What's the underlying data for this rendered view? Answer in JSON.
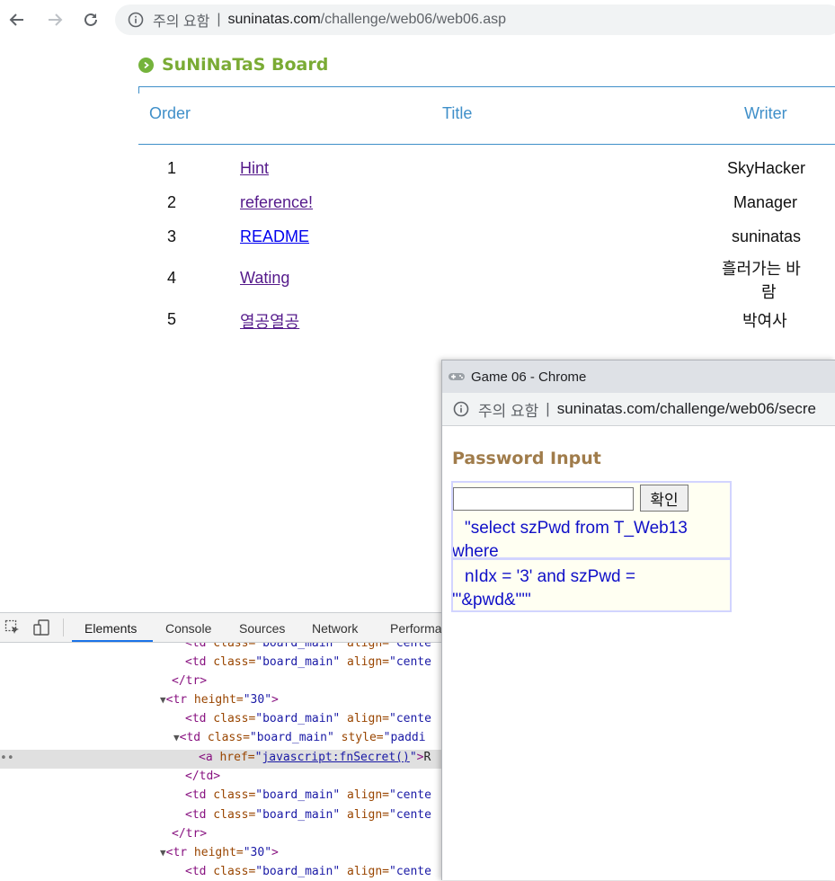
{
  "browser": {
    "security_label": "주의 요함",
    "separator": "|",
    "url_host": "suninatas.com",
    "url_path": "/challenge/web06/web06.asp"
  },
  "board": {
    "title": "SuNiNaTaS Board",
    "columns": [
      "Order",
      "Title",
      "Writer"
    ],
    "rows": [
      {
        "order": "1",
        "title": "Hint",
        "writer": "SkyHacker",
        "visited": true
      },
      {
        "order": "2",
        "title": "reference!",
        "writer": "Manager",
        "visited": true
      },
      {
        "order": "3",
        "title": "README",
        "writer": "suninatas",
        "visited": false
      },
      {
        "order": "4",
        "title": "Wating",
        "writer_line1": "흘러가는 바",
        "writer_line2": "람",
        "visited": true
      },
      {
        "order": "5",
        "title": "열공열공",
        "writer": "박여사",
        "visited": true
      }
    ]
  },
  "devtools": {
    "tabs": [
      "Elements",
      "Console",
      "Sources",
      "Network",
      "Performa"
    ],
    "active_tab": "Elements",
    "code_lines": {
      "l0": {
        "tag": "<td",
        "attr1": " class=",
        "val1": "\"board_main\"",
        "attr2": " align=",
        "val2": "\"cente"
      },
      "l1": {
        "tag": "<td",
        "attr1": " class=",
        "val1": "\"board_main\"",
        "attr2": " align=",
        "val2": "\"cente"
      },
      "l2": {
        "tag": "</tr>"
      },
      "l3": {
        "tag": "<tr",
        "attr1": " height=",
        "val1": "\"30\"",
        "end": ">"
      },
      "l4": {
        "tag": "<td",
        "attr1": " class=",
        "val1": "\"board_main\"",
        "attr2": " align=",
        "val2": "\"cente"
      },
      "l5": {
        "tag": "<td",
        "attr1": " class=",
        "val1": "\"board_main\"",
        "attr2": " style=",
        "val2": "\"paddi"
      },
      "l6": {
        "tag": "<a",
        "attr1": " href=",
        "q1": "\"",
        "link": "javascript:fnSecret()",
        "q2": "\"",
        "end": ">",
        "text": "R"
      },
      "l7": {
        "tag": "</td>"
      },
      "l8": {
        "tag": "<td",
        "attr1": " class=",
        "val1": "\"board_main\"",
        "attr2": " align=",
        "val2": "\"cente"
      },
      "l9": {
        "tag": "<td",
        "attr1": " class=",
        "val1": "\"board_main\"",
        "attr2": " align=",
        "val2": "\"cente"
      },
      "l10": {
        "tag": "</tr>"
      },
      "l11": {
        "tag": "<tr",
        "attr1": " height=",
        "val1": "\"30\"",
        "end": ">"
      },
      "l12": {
        "tag": "<td",
        "attr1": " class=",
        "val1": "\"board_main\"",
        "attr2": " align=",
        "val2": "\"cente"
      }
    }
  },
  "popup": {
    "window_title": "Game 06 - Chrome",
    "security_label": "주의 요함",
    "separator": "|",
    "url": "suninatas.com/challenge/web06/secre",
    "heading": "Password Input",
    "password_value": "",
    "confirm_button": "확인",
    "sql_line1": "\"select szPwd from T_Web13",
    "sql_line2": "where",
    "sql_line3": "nIdx = '3' and szPwd =",
    "sql_line4": "'\"&pwd&\"'\""
  }
}
